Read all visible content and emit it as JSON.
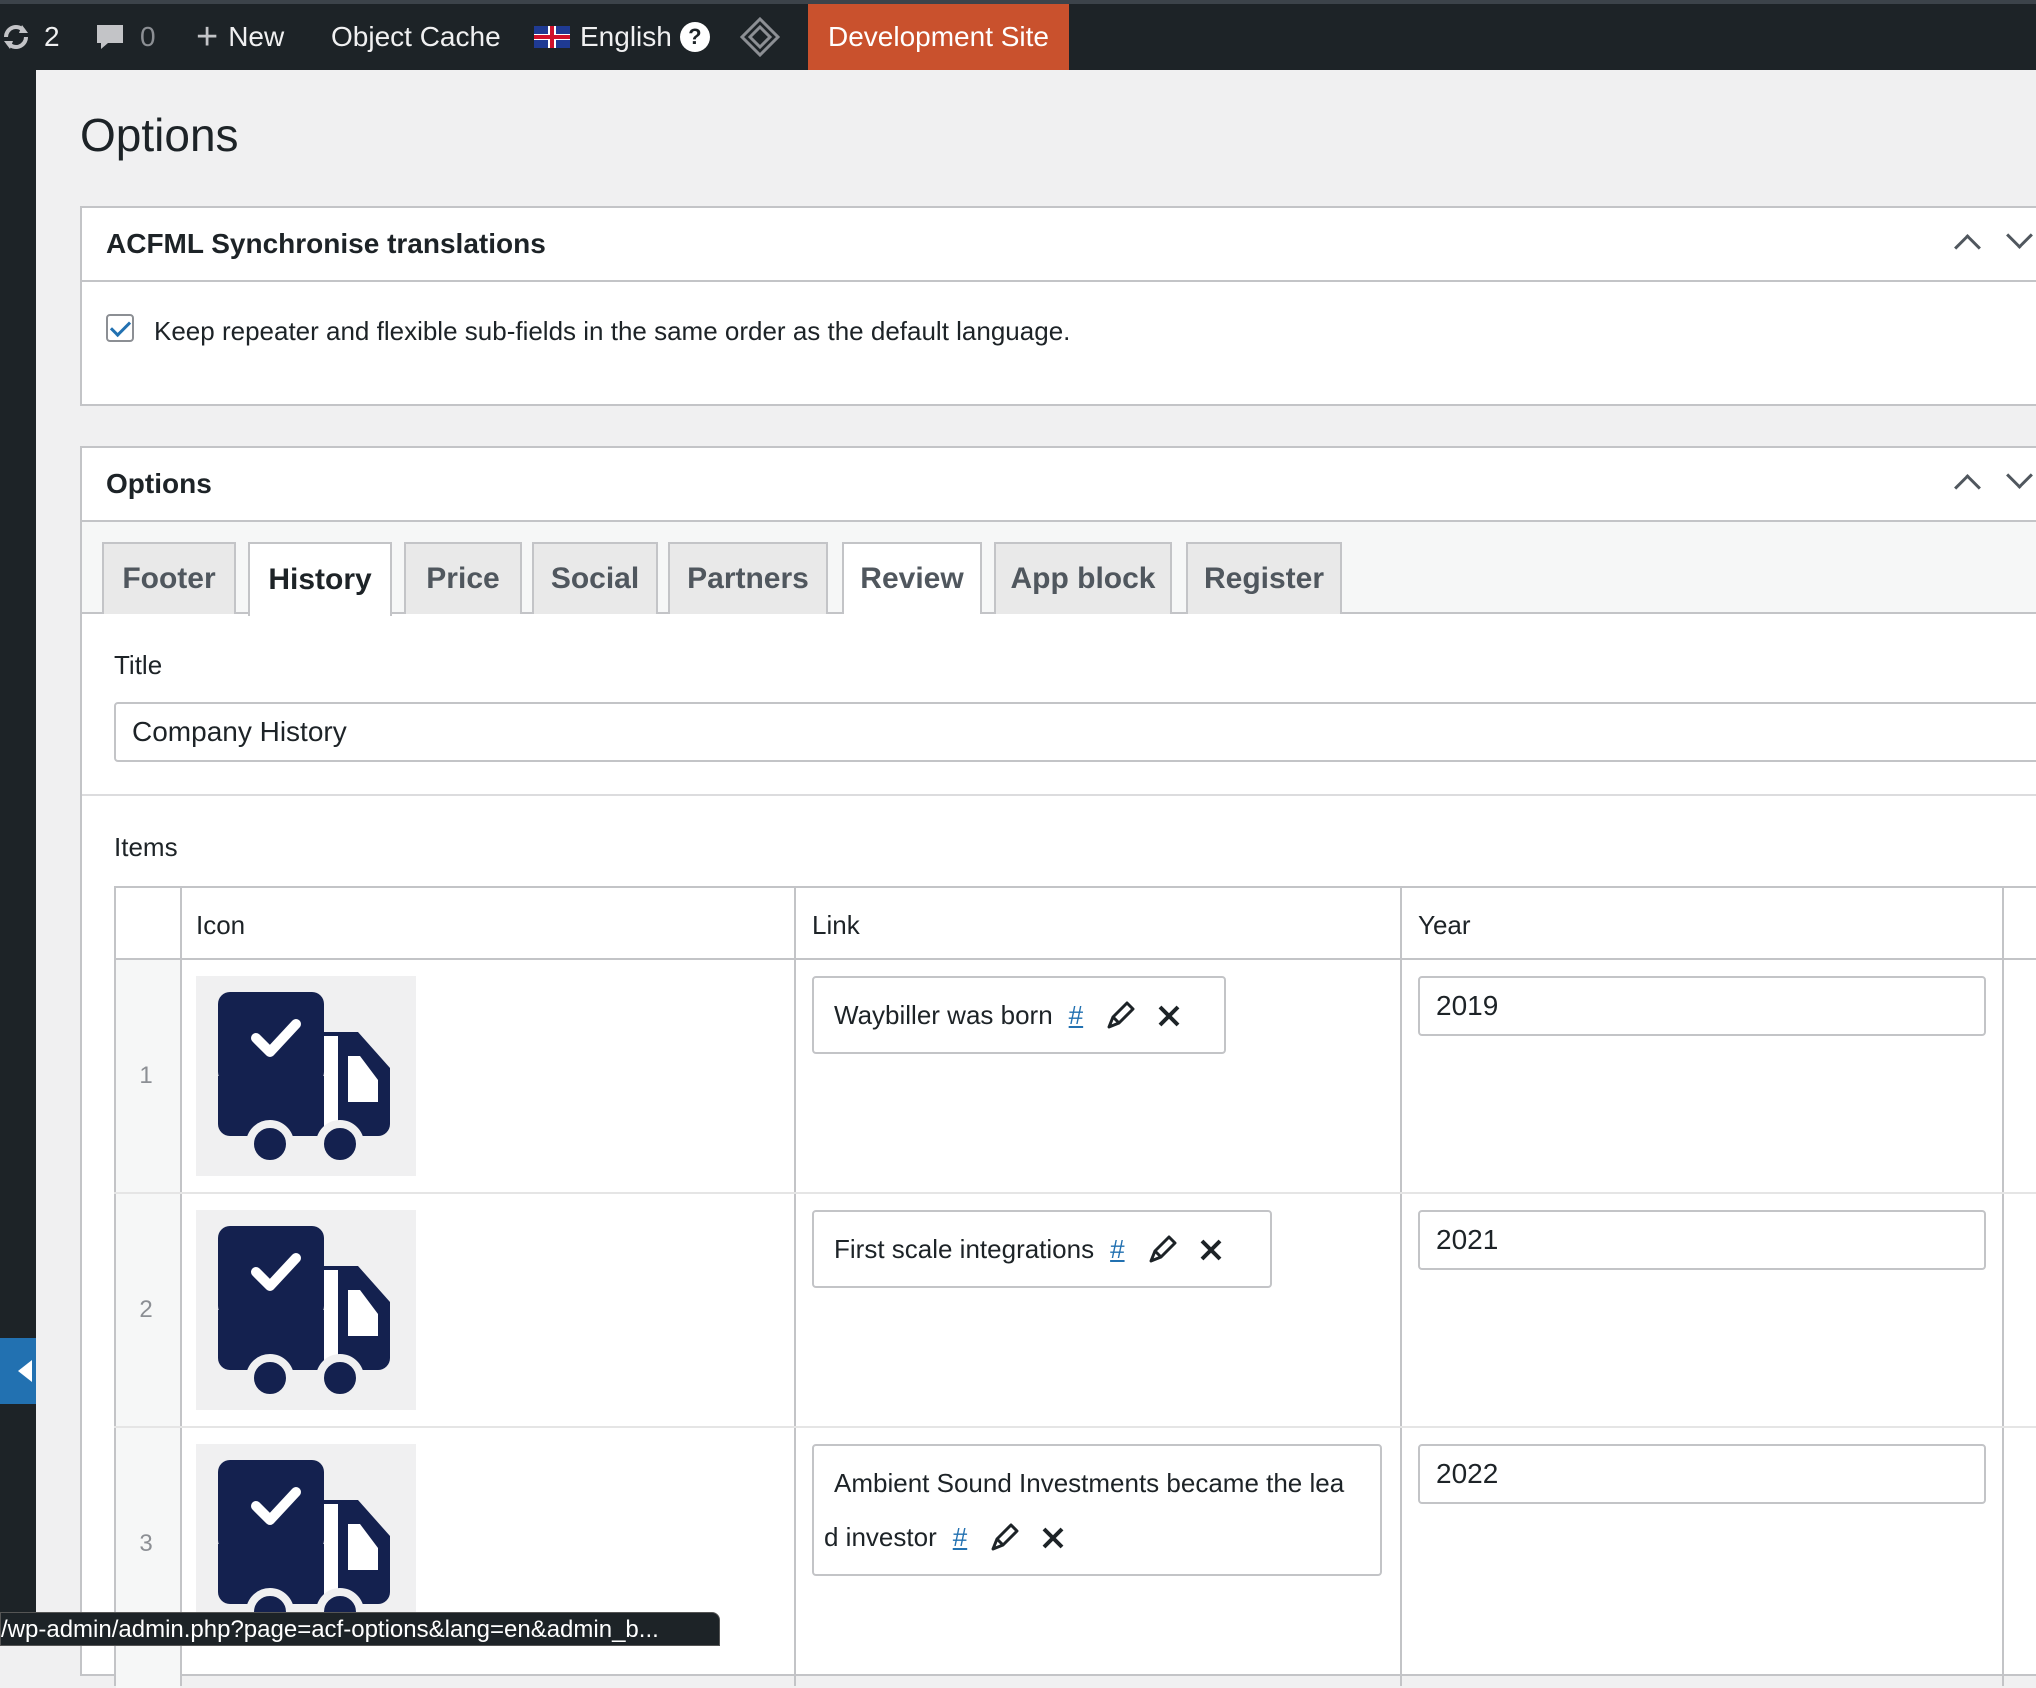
{
  "adminbar": {
    "updates_count": "2",
    "comments_count": "0",
    "new_label": "New",
    "object_cache_label": "Object Cache",
    "language_label": "English",
    "help_label": "?",
    "dev_site_label": "Development Site"
  },
  "page": {
    "title": "Options"
  },
  "sync_box": {
    "title": "ACFML Synchronise translations",
    "checkbox_label": "Keep repeater and flexible sub-fields in the same order as the default language.",
    "checked": true
  },
  "options_box": {
    "title": "Options",
    "tabs": [
      {
        "label": "Footer"
      },
      {
        "label": "History"
      },
      {
        "label": "Price"
      },
      {
        "label": "Social"
      },
      {
        "label": "Partners"
      },
      {
        "label": "Review"
      },
      {
        "label": "App block"
      },
      {
        "label": "Register"
      }
    ],
    "active_tab": "History",
    "title_field": {
      "label": "Title",
      "value": "Company History"
    },
    "items": {
      "label": "Items",
      "columns": [
        "Icon",
        "Link",
        "Year"
      ],
      "rows": [
        {
          "num": "1",
          "icon": "truck-check-icon",
          "link_text": "Waybiller was born",
          "link_url": "#",
          "year": "2019"
        },
        {
          "num": "2",
          "icon": "truck-check-icon",
          "link_text": "First scale integrations",
          "link_url": "#",
          "year": "2021"
        },
        {
          "num": "3",
          "icon": "truck-check-icon",
          "link_text_line1": "Ambient Sound Investments became the lea",
          "link_text_line2": "d investor",
          "link_url": "#",
          "year": "2022"
        }
      ]
    }
  },
  "statusbar": {
    "url": "/wp-admin/admin.php?page=acf-options&lang=en&admin_b..."
  },
  "colors": {
    "icon_navy": "#14214f",
    "accent_blue": "#2271b1",
    "dev_site_bg": "#c9512d"
  }
}
